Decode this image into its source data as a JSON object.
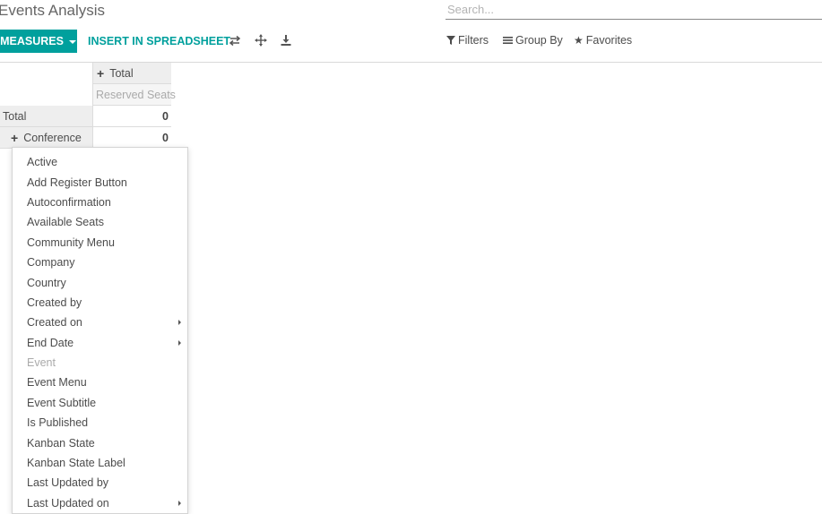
{
  "header": {
    "title": "Events Analysis",
    "search_placeholder": "Search..."
  },
  "toolbar": {
    "measures_label": "MEASURES",
    "spreadsheet_label": "INSERT IN SPREADSHEET",
    "icons": [
      "flip-axis-icon",
      "expand-all-icon",
      "download-icon"
    ],
    "filters_label": "Filters",
    "groupby_label": "Group By",
    "favorites_label": "Favorites"
  },
  "pivot": {
    "col_header": "Total",
    "measure_header": "Reserved Seats",
    "rows": [
      {
        "label": "Total",
        "value": "0"
      },
      {
        "label": "Conference",
        "value": "0"
      }
    ]
  },
  "dropdown": {
    "items": [
      {
        "label": "Active",
        "submenu": false,
        "disabled": false
      },
      {
        "label": "Add Register Button",
        "submenu": false,
        "disabled": false
      },
      {
        "label": "Autoconfirmation",
        "submenu": false,
        "disabled": false
      },
      {
        "label": "Available Seats",
        "submenu": false,
        "disabled": false
      },
      {
        "label": "Community Menu",
        "submenu": false,
        "disabled": false
      },
      {
        "label": "Company",
        "submenu": false,
        "disabled": false
      },
      {
        "label": "Country",
        "submenu": false,
        "disabled": false
      },
      {
        "label": "Created by",
        "submenu": false,
        "disabled": false
      },
      {
        "label": "Created on",
        "submenu": true,
        "disabled": false
      },
      {
        "label": "End Date",
        "submenu": true,
        "disabled": false
      },
      {
        "label": "Event",
        "submenu": false,
        "disabled": true
      },
      {
        "label": "Event Menu",
        "submenu": false,
        "disabled": false
      },
      {
        "label": "Event Subtitle",
        "submenu": false,
        "disabled": false
      },
      {
        "label": "Is Published",
        "submenu": false,
        "disabled": false
      },
      {
        "label": "Kanban State",
        "submenu": false,
        "disabled": false
      },
      {
        "label": "Kanban State Label",
        "submenu": false,
        "disabled": false
      },
      {
        "label": "Last Updated by",
        "submenu": false,
        "disabled": false
      },
      {
        "label": "Last Updated on",
        "submenu": true,
        "disabled": false
      }
    ]
  },
  "colors": {
    "primary": "#00a09d",
    "text": "#4c4c4c",
    "muted": "#aaaaaa"
  }
}
